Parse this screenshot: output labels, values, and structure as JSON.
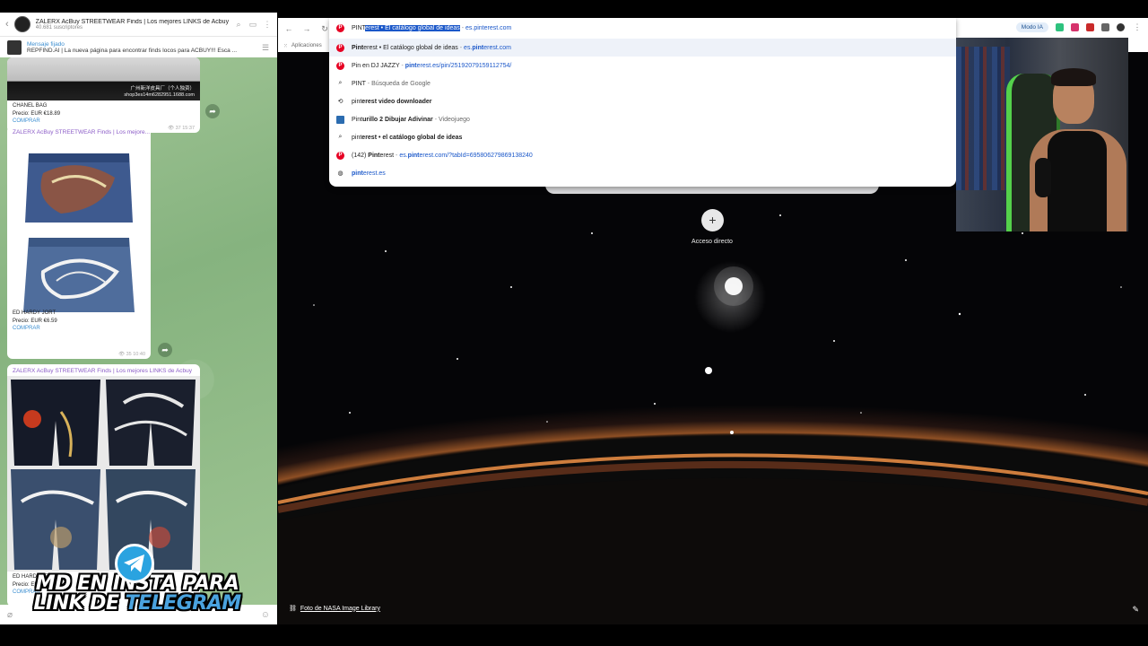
{
  "telegram": {
    "channel_title": "ZALERX AcBuy STREETWEAR Finds | Los mejores LINKS de Acbuy",
    "subscribers": "40.681 suscriptores",
    "pinned_title": "Mensaje fijado",
    "pinned_body": "REPFIND.AI | La nueva página para encontrar finds locos para ACBUY!!! Esca ...",
    "messages": [
      {
        "channel": "",
        "photo_caption": "广州新洋皮具厂（个人独资） shop3es14m6282951.1688.com",
        "item_name": "CHANEL BAG",
        "price": "Precio: EUR €18.89",
        "buy": "COMPRAR",
        "views": "37",
        "time": "15:37"
      },
      {
        "channel": "ZALERX AcBuy STREETWEAR Finds | Los mejore...",
        "item_name": "ED HARDY JORT",
        "price": "Precio: EUR €6.59",
        "buy": "COMPRAR",
        "views": "35",
        "time": "10:40"
      },
      {
        "channel": "ZALERX AcBuy STREETWEAR Finds | Los mejores LINKS de Acbuy",
        "item_name": "ED HARDY JEANS",
        "price": "Precio: EUR €7...",
        "buy": "COMPRAR"
      }
    ],
    "promo_line1": "MD EN INSTA PARA",
    "promo_line2": "LINK DE TELEGRAM"
  },
  "chrome": {
    "apps_label": "Aplicaciones",
    "modo_ia": "Modo IA",
    "omnibox": {
      "typed": "PINT",
      "completion": "erest • El catálogo global de ideas",
      "dash": " - ",
      "url": "es.pinterest.com"
    },
    "suggestions": [
      {
        "icon": "pinterest",
        "bold": "Pint",
        "rest": "erest • El catálogo global de ideas",
        "dash": " - ",
        "url_pre": "es.",
        "url_bold": "pint",
        "url_post": "erest.com"
      },
      {
        "icon": "pinterest",
        "bold": "",
        "rest": "Pin en DJ JAZZY",
        "dash": " - ",
        "url_pre": "",
        "url_bold": "pint",
        "url_post": "erest.es/pin/25192079159112754/"
      },
      {
        "icon": "search",
        "bold": "",
        "rest": "PINT",
        "dash": " - ",
        "gray": "Búsqueda de Google"
      },
      {
        "icon": "history",
        "bold": "",
        "rest": "pint",
        "bold2": "erest video downloader"
      },
      {
        "icon": "game",
        "bold": "",
        "rest": "Pint",
        "bold2": "urillo 2 Dibujar Adivinar",
        "dash": " - ",
        "gray": "Videojuego"
      },
      {
        "icon": "search",
        "bold": "",
        "rest": "pint",
        "bold2": "erest • el catálogo global de ideas"
      },
      {
        "icon": "pinterest",
        "bold": "",
        "rest": "(142) ",
        "bold2": "Pint",
        "rest2": "erest",
        "dash": " - ",
        "url_pre": "es.",
        "url_bold": "pint",
        "url_post": "erest.com/?tabId=695806279869138240"
      },
      {
        "icon": "globe",
        "bold": "",
        "rest": "",
        "url_pre": "",
        "url_bold": "pint",
        "url_post": "erest.es"
      }
    ],
    "shortcut_label": "Acceso directo",
    "photo_credit": "Foto de NASA Image Library"
  }
}
